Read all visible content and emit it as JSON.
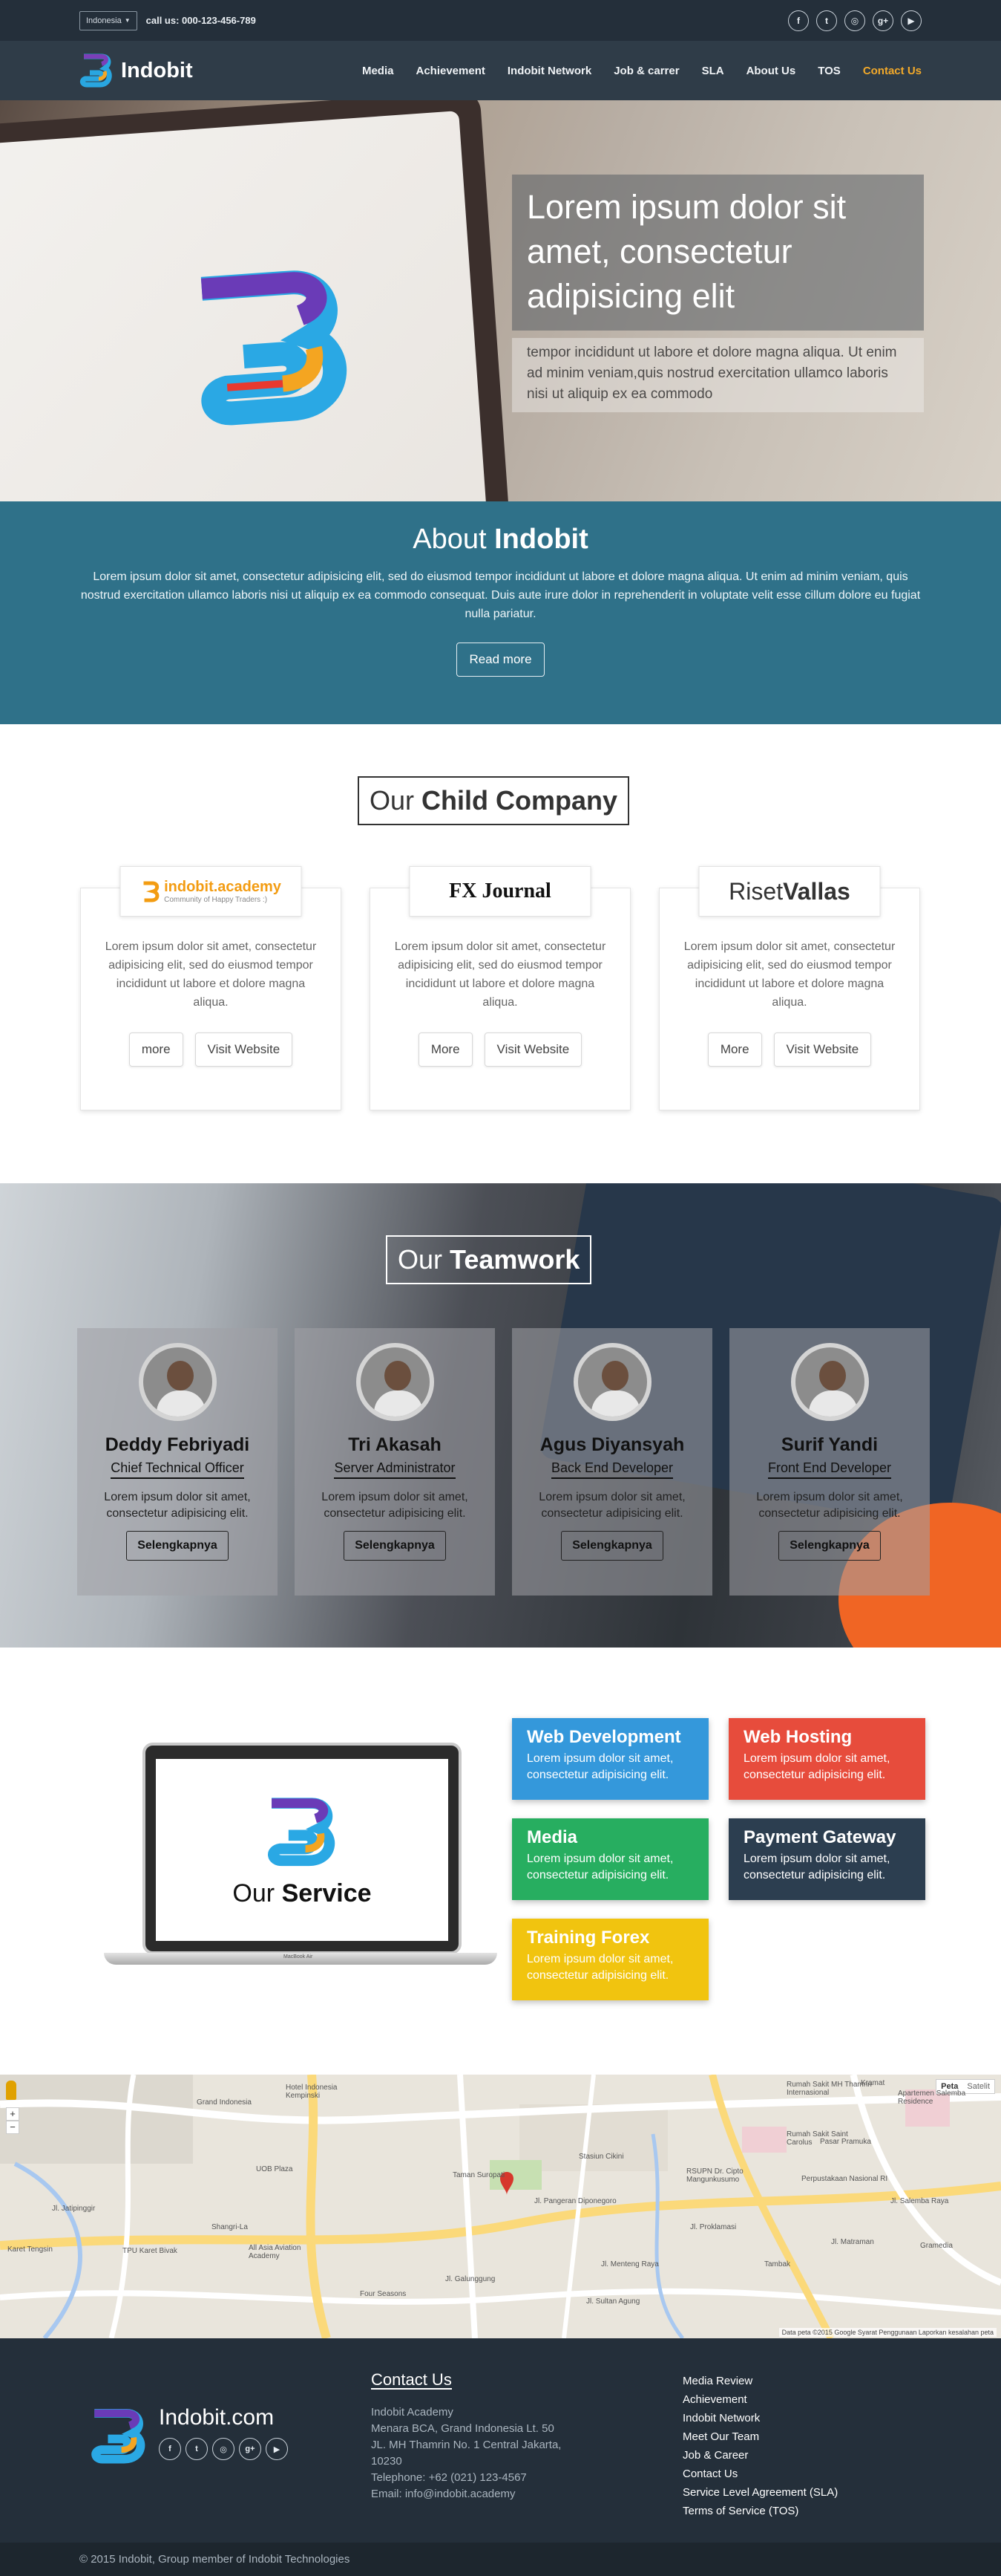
{
  "topbar": {
    "language": "Indonesia",
    "call": "call us: 000-123-456-789",
    "social_icons": [
      "facebook-icon",
      "twitter-icon",
      "instagram-icon",
      "google-plus-icon",
      "youtube-icon"
    ]
  },
  "nav": {
    "brand": "Indobit",
    "items": [
      "Media",
      "Achievement",
      "Indobit Network",
      "Job & carrer",
      "SLA",
      "About Us",
      "TOS",
      "Contact Us"
    ],
    "active_color": "#f2a92a"
  },
  "hero": {
    "title": "Lorem ipsum dolor sit amet, consectetur adipisicing elit",
    "subtitle": "tempor incididunt ut labore et dolore magna aliqua. Ut enim ad minim veniam,quis nostrud exercitation ullamco laboris nisi ut aliquip ex ea commodo"
  },
  "about": {
    "title_light": "About",
    "title_bold": "Indobit",
    "text": "Lorem ipsum dolor sit amet, consectetur adipisicing elit, sed do eiusmod tempor incididunt ut labore et dolore magna aliqua. Ut enim ad minim veniam, quis nostrud exercitation ullamco laboris nisi ut aliquip ex ea commodo consequat. Duis aute irure dolor in reprehenderit in voluptate velit esse cillum dolore eu fugiat nulla pariatur.",
    "button": "Read more",
    "color": "#2f7189"
  },
  "child": {
    "title_light": "Our",
    "title_bold": "Child Company",
    "cards": [
      {
        "logo_main": "indobit.academy",
        "logo_sub": "Community of Happy Traders :)",
        "text": "Lorem ipsum dolor sit amet, consectetur adipisicing elit, sed do eiusmod tempor incididunt ut labore et dolore magna aliqua.",
        "more": "more",
        "visit": "Visit Website"
      },
      {
        "logo_main": "FX Journal",
        "text": "Lorem ipsum dolor sit amet, consectetur adipisicing elit, sed do eiusmod tempor incididunt ut labore et dolore magna aliqua.",
        "more": "More",
        "visit": "Visit Website"
      },
      {
        "logo_light": "Riset",
        "logo_bold": "Vallas",
        "text": "Lorem ipsum dolor sit amet, consectetur adipisicing elit, sed do eiusmod tempor incididunt ut labore et dolore magna aliqua.",
        "more": "More",
        "visit": "Visit Website"
      }
    ]
  },
  "team": {
    "title_light": "Our",
    "title_bold": "Teamwork",
    "members": [
      {
        "name": "Deddy Febriyadi",
        "role": "Chief Technical Officer",
        "text": "Lorem ipsum dolor sit amet, consectetur adipisicing elit.",
        "button": "Selengkapnya"
      },
      {
        "name": "Tri Akasah",
        "role": "Server Administrator",
        "text": "Lorem ipsum dolor sit amet, consectetur adipisicing elit.",
        "button": "Selengkapnya"
      },
      {
        "name": "Agus Diyansyah",
        "role": "Back End Developer",
        "text": "Lorem ipsum dolor sit amet, consectetur adipisicing elit.",
        "button": "Selengkapnya"
      },
      {
        "name": "Surif Yandi",
        "role": "Front End Developer",
        "text": "Lorem ipsum dolor sit amet, consectetur adipisicing elit.",
        "button": "Selengkapnya"
      }
    ]
  },
  "service": {
    "title_light": "Our",
    "title_bold": "Service",
    "macbook_label": "MacBook Air",
    "items": [
      {
        "title": "Web Development",
        "text": "Lorem ipsum dolor sit amet, consectetur adipisicing elit.",
        "color": "#3498db"
      },
      {
        "title": "Web Hosting",
        "text": "Lorem ipsum dolor sit amet, consectetur adipisicing elit.",
        "color": "#e74c3c"
      },
      {
        "title": "Media",
        "text": "Lorem ipsum dolor sit amet, consectetur adipisicing elit.",
        "color": "#27ae60"
      },
      {
        "title": "Payment Gateway",
        "text": "Lorem ipsum dolor sit amet, consectetur adipisicing elit.",
        "color": "#2c3e50"
      },
      {
        "title": "Training Forex",
        "text": "Lorem ipsum dolor sit amet, consectetur adipisicing elit.",
        "color": "#f1c40f"
      }
    ]
  },
  "map": {
    "map_button": "Peta",
    "sat_button": "Satelit",
    "labels": [
      "Grand Indonesia",
      "Hotel Indonesia Kempinski",
      "UOB Plaza",
      "Jl. Jatipinggir",
      "Shangri-La",
      "Karet Tengsin",
      "TPU Karet Bivak",
      "All Asia Aviation Academy",
      "Four Seasons",
      "Taman Suropati",
      "Stasiun Cikini",
      "Jl. Pangeran Diponegoro",
      "RSUPN Dr. Cipto Mangunkusumo",
      "Rumah Sakit Saint Carolus",
      "Perpustakaan Nasional RI",
      "Pasar Pramuka",
      "Rumah Sakit MH Thamrin Internasional",
      "Kramat",
      "Apartemen Salemba Residence",
      "Jl. Menteng Raya",
      "Jl. Sultan Agung",
      "Jl. Proklamasi",
      "Jl. Salemba Raya",
      "Jl. Galunggung",
      "Tambak",
      "Jl. Matraman",
      "Gramedia"
    ],
    "attribution": "Data peta ©2015 Google   Syarat Penggunaan   Laporkan kesalahan peta"
  },
  "footer": {
    "brand": "Indobit.com",
    "contact_title": "Contact Us",
    "contact_lines": [
      "Indobit Academy",
      "Menara BCA, Grand Indonesia Lt. 50",
      "JL. MH Thamrin No. 1 Central Jakarta,",
      "10230",
      "Telephone: +62 (021) 123-4567",
      "Email: info@indobit.academy"
    ],
    "links": [
      "Media Review",
      "Achievement",
      "Indobit Network",
      "Meet Our Team",
      "Job & Career",
      "Contact Us",
      "Service Level Agreement (SLA)",
      "Terms of Service (TOS)"
    ],
    "copyright": "© 2015 Indobit, Group member of Indobit Technologies"
  }
}
